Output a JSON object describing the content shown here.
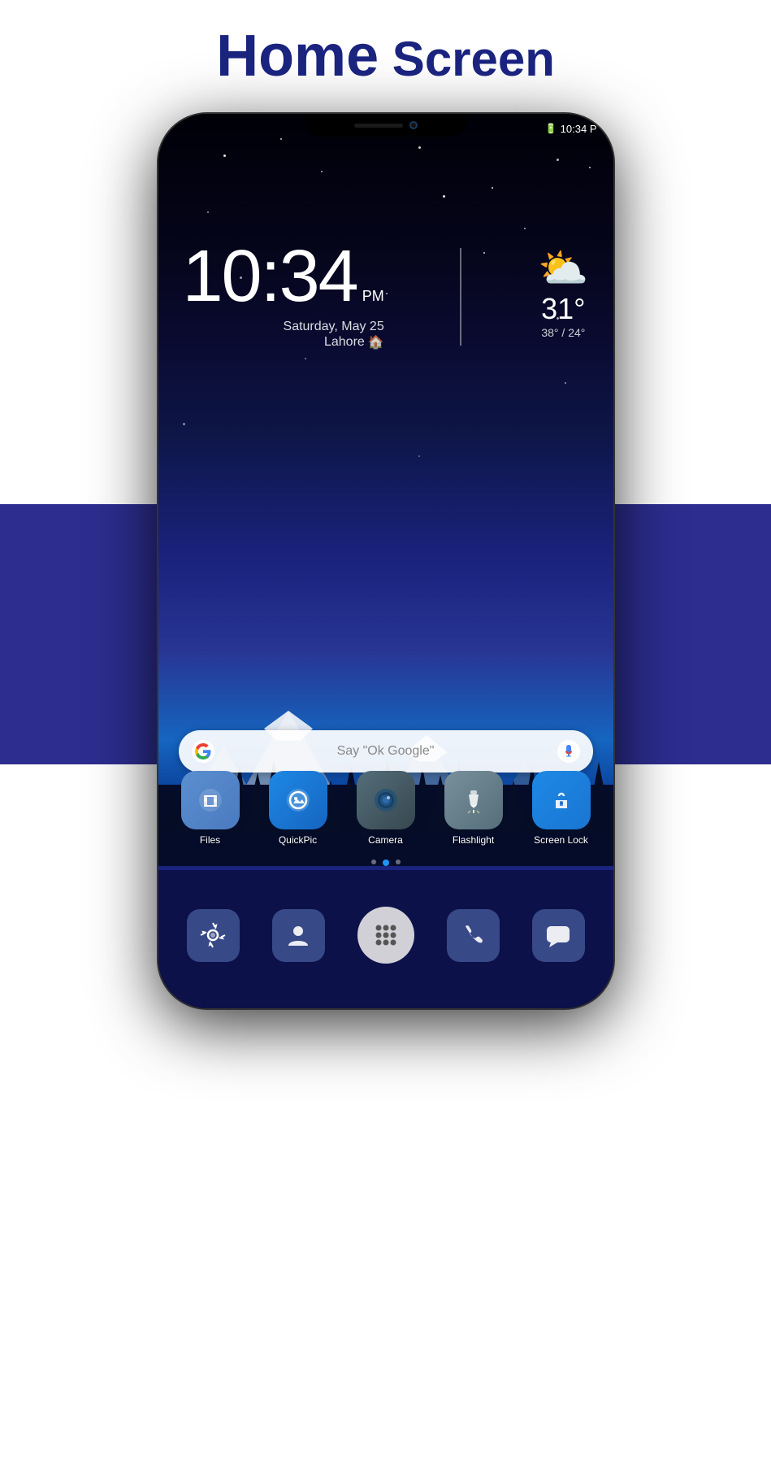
{
  "page": {
    "title_bold": "Home",
    "title_regular": " Screen"
  },
  "status_bar": {
    "time": "10:34 P",
    "battery": "🔋"
  },
  "clock": {
    "time": "10:34",
    "ampm": "PM",
    "date": "Saturday, May 25",
    "location": "Lahore"
  },
  "weather": {
    "temp": "31°",
    "range": "38° / 24°"
  },
  "search": {
    "placeholder": "Say \"Ok Google\""
  },
  "apps": [
    {
      "id": "files",
      "label": "Files",
      "color": "#5b8fcf"
    },
    {
      "id": "quickpic",
      "label": "QuickPic",
      "color": "#1e88e5"
    },
    {
      "id": "camera",
      "label": "Camera",
      "color": "#546e7a"
    },
    {
      "id": "flashlight",
      "label": "Flashlight",
      "color": "#78909c"
    },
    {
      "id": "screenlock",
      "label": "Screen Lock",
      "color": "#1e88e5"
    }
  ],
  "dock": [
    {
      "id": "settings",
      "label": "Settings"
    },
    {
      "id": "contacts",
      "label": "Contacts"
    },
    {
      "id": "apps",
      "label": "All Apps"
    },
    {
      "id": "phone",
      "label": "Phone"
    },
    {
      "id": "messages",
      "label": "Messages"
    }
  ],
  "page_dots": [
    {
      "active": false
    },
    {
      "active": true
    },
    {
      "active": false
    }
  ]
}
